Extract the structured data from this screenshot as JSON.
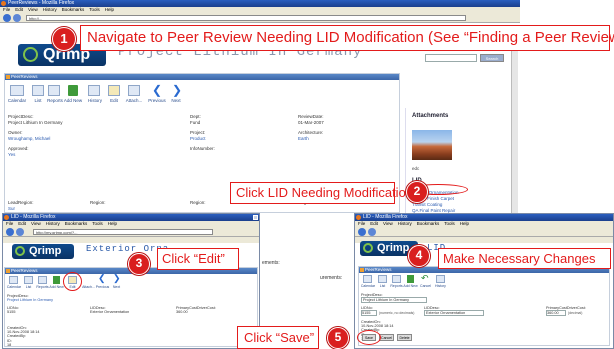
{
  "main_window": {
    "title": "PeerReviews - Mozilla Firefox",
    "menu": [
      "File",
      "Edit",
      "View",
      "History",
      "Bookmarks",
      "Tools",
      "Help"
    ],
    "url": "http://...",
    "search_btn": "Search",
    "header_title": "Project Lithium In Germany",
    "panel_title": "PeerReviews",
    "toolbar": [
      "Calendar",
      "List",
      "Reports",
      "Add New",
      "History",
      "Edit",
      "Attach...",
      "Previous",
      "Next"
    ],
    "fields": {
      "project_desc_label": "ProjectDesc:",
      "project_desc_value": "Project Lithium In Germany",
      "dept_label": "Dept:",
      "dept_value": "Fund",
      "review_date_label": "ReviewDate:",
      "review_date_value": "01-Mar-2007",
      "owner_label": "Owner:",
      "owner_value": "Wroughamp, Michael",
      "project_label": "Project:",
      "project_value": "Product",
      "architecture_label": "Architecture:",
      "architecture_value": "Earth",
      "approved_label": "Approved:",
      "approved_value": "Yes",
      "infonumber_label": "InfoNumber:",
      "lead_region_label": "LeadRegion:",
      "lead_region_value": "Sur",
      "region_label": "Region:",
      "region2_label": "Region:",
      "region3_label": "Region:"
    },
    "attachments_label": "Attachments",
    "attachment_caption": "edc",
    "lid_label": "LID",
    "lid_items": [
      "Exterior Ornamentation",
      "Interior Finish Carpet",
      "Transit Coating",
      "QA Final Paint Repair",
      "Interior and Exterior Repair"
    ]
  },
  "edit_window": {
    "title": "LID - Mozilla Firefox",
    "menu": [
      "File",
      "Edit",
      "View",
      "History",
      "Bookmarks",
      "Tools",
      "Help"
    ],
    "url": "http://my.qrimp.com/?...",
    "header_title": "Exterior Orna...",
    "panel_title": "PeerReviews",
    "toolbar": [
      "Calendar",
      "List",
      "Reports",
      "Add New",
      "Edit",
      "Attach...",
      "Previous",
      "Next"
    ],
    "project_desc_label": "ProjectDesc:",
    "project_desc_value": "Project Lithium In Germany",
    "lid_no_label": "LIDNo:",
    "lid_no_value": "5155",
    "lid_desc_label": "LIDDesc:",
    "lid_desc_value": "Exterior Ornamentation",
    "primary_label": "PrimaryCostDriverCost:",
    "primary_value": "360.00",
    "created_label": "CreatedOn:",
    "created_value": "10-Nov-2008 18:14",
    "created_by_label": "CreatedBy:",
    "id_label": "ID:",
    "id_value": "18",
    "ements_text": "ements:"
  },
  "save_window": {
    "title": "LID - Mozilla Firefox",
    "menu": [
      "File",
      "Edit",
      "View",
      "History",
      "Bookmarks",
      "Tools",
      "Help"
    ],
    "header_title": "LID",
    "panel_title": "PeerReviews",
    "toolbar": [
      "Calendar",
      "List",
      "Reports",
      "Add New",
      "Cancel",
      "History"
    ],
    "project_desc_label": "ProjectDesc:",
    "project_desc_value": "Project Lithium In Germany",
    "lid_no_label": "LIDNo:",
    "lid_no_value": "5155",
    "lid_no_hint": "(numeric, no decimals)",
    "lid_desc_label": "LIDDesc:",
    "lid_desc_value": "Exterior Ornamentation",
    "primary_label": "PrimaryCostDriverCost:",
    "primary_value": "360.00",
    "primary_hint": "(decimal)",
    "created_label": "CreatedOn:",
    "created_value": "10-Nov-2008 18:14",
    "created_by_label": "CreatedBy:",
    "id_label": "ID:",
    "id_value": "18",
    "buttons": [
      "Save",
      "Cancel",
      "Delete"
    ]
  },
  "side_text": {
    "left_ements": "ements:",
    "mid_urements": "urements:"
  },
  "callouts": {
    "c1": "Navigate to Peer Review Needing LID Modification (See “Finding a Peer Review”)",
    "c2": "Click LID Needing Modification",
    "c3": "Click “Edit”",
    "c4": "Make Necessary Changes",
    "c5": "Click “Save”"
  },
  "badges": [
    "1",
    "2",
    "3",
    "4",
    "5"
  ],
  "logo_text": "Qrimp",
  "colors": {
    "callout_red": "#e31b1b",
    "badge_red": "#d91f1f",
    "link_blue": "#2a5ab0",
    "title_blue": "#1b3f8c"
  }
}
